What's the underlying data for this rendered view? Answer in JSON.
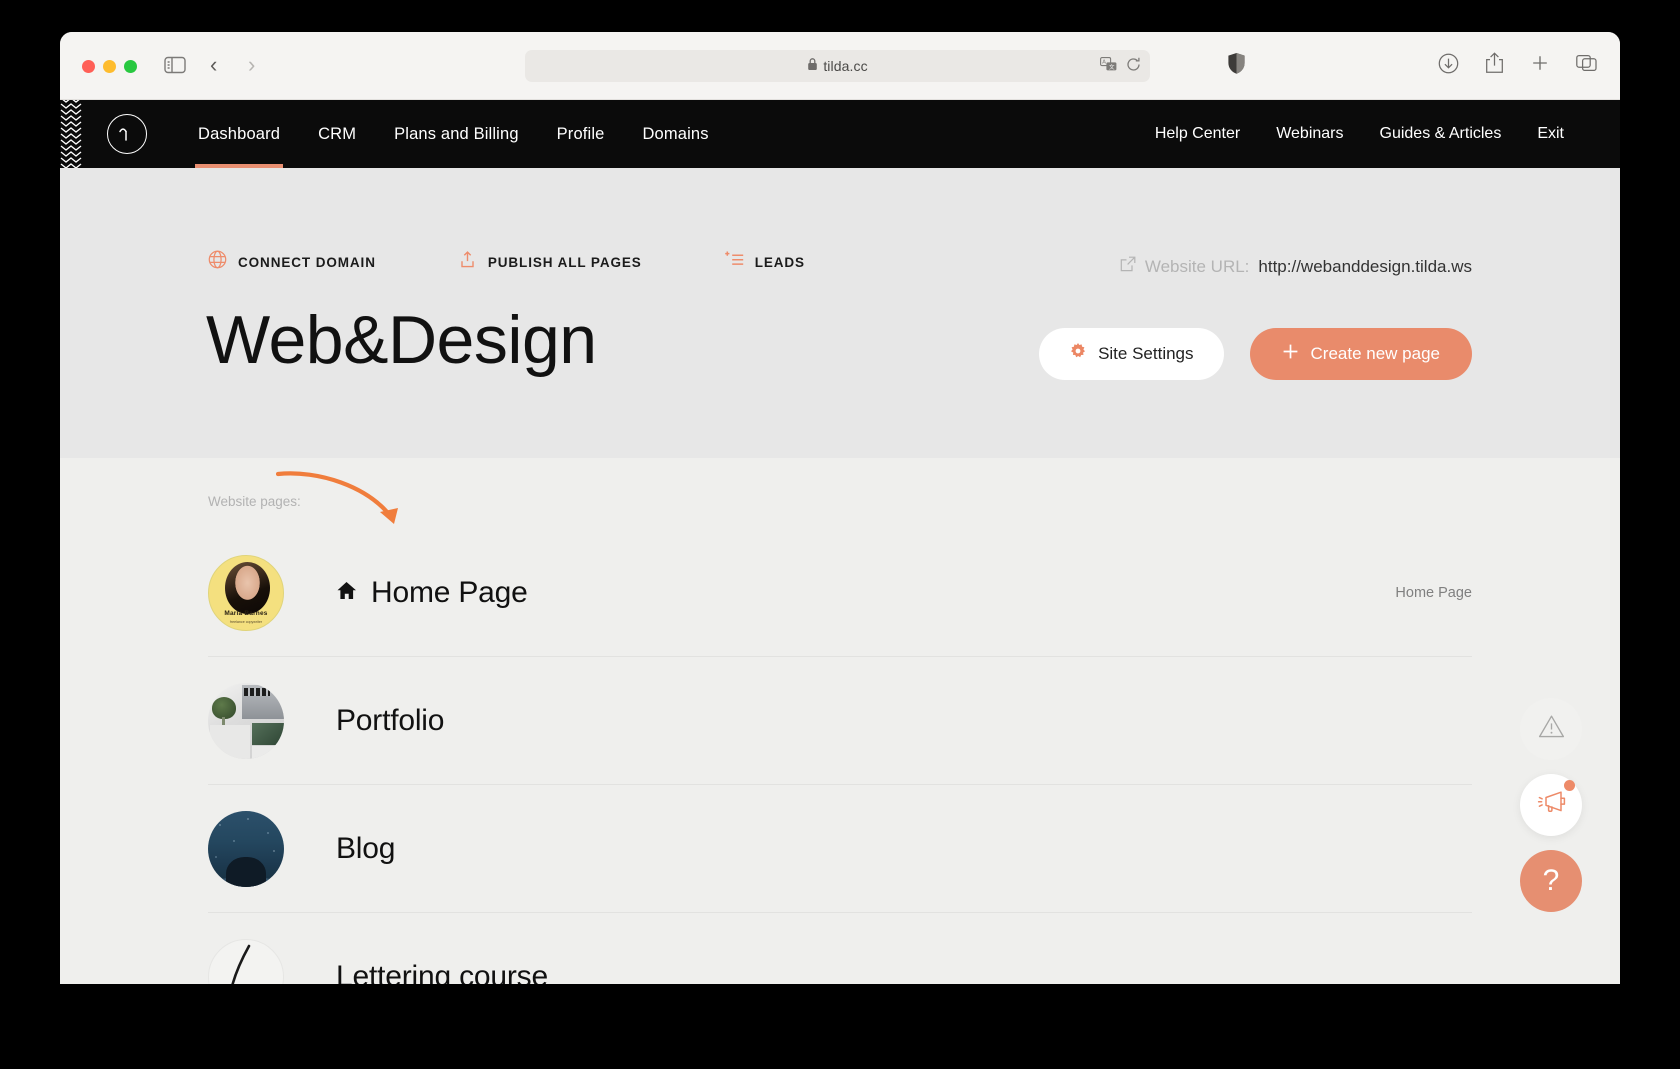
{
  "browser": {
    "url_text": "tilda.cc",
    "lock_icon": "lock-icon",
    "back_glyph": "‹",
    "forward_glyph": "›",
    "sidebar_icon": "sidebar-toggle-icon",
    "translate_icon": "translate-icon",
    "reload_icon": "reload-icon",
    "shield_icon": "privacy-shield-icon",
    "download_icon": "download-icon",
    "share_icon": "share-icon",
    "newtab_icon": "plus-icon",
    "tabs_icon": "tab-overview-icon"
  },
  "topnav": {
    "logo_glyph": "∼",
    "left_items": [
      {
        "label": "Dashboard",
        "active": true
      },
      {
        "label": "CRM",
        "active": false
      },
      {
        "label": "Plans and Billing",
        "active": false
      },
      {
        "label": "Profile",
        "active": false
      },
      {
        "label": "Domains",
        "active": false
      }
    ],
    "right_items": [
      {
        "label": "Help Center"
      },
      {
        "label": "Webinars"
      },
      {
        "label": "Guides & Articles"
      },
      {
        "label": "Exit"
      }
    ]
  },
  "hero": {
    "actions": [
      {
        "label": "CONNECT DOMAIN",
        "icon": "globe-icon"
      },
      {
        "label": "PUBLISH ALL PAGES",
        "icon": "upload-icon"
      },
      {
        "label": "LEADS",
        "icon": "add-to-list-icon"
      }
    ],
    "website_url_label": "Website URL:",
    "website_url_value": "http://webanddesign.tilda.ws",
    "website_url_icon": "external-link-icon",
    "site_title": "Web&Design",
    "site_settings_label": "Site Settings",
    "site_settings_icon": "gear-icon",
    "create_page_label": "Create new page",
    "create_page_icon": "plus-icon"
  },
  "pages": {
    "section_label": "Website pages:",
    "items": [
      {
        "title": "Home Page",
        "tag": "Home Page",
        "icon": "home-icon",
        "thumb": "maria-barnes-portrait",
        "thumb_name": "Maria Barnes",
        "thumb_sub": "freelance copywriter"
      },
      {
        "title": "Portfolio",
        "tag": "",
        "icon": "",
        "thumb": "workspace-photo"
      },
      {
        "title": "Blog",
        "tag": "",
        "icon": "",
        "thumb": "night-sky-photo"
      },
      {
        "title": "Lettering course",
        "tag": "",
        "icon": "",
        "thumb": "lettering-sketch"
      }
    ]
  },
  "fabs": [
    {
      "name": "warning-button",
      "icon": "warning-triangle-icon",
      "badge": false
    },
    {
      "name": "announcements-button",
      "icon": "megaphone-icon",
      "badge": true
    },
    {
      "name": "help-button",
      "icon": "question-mark-icon",
      "label": "?",
      "badge": false
    }
  ],
  "colors": {
    "accent": "#e98b6b",
    "nav_bg": "#0b0b0b",
    "hero_bg": "#e7e7e7",
    "list_bg": "#efefed"
  }
}
